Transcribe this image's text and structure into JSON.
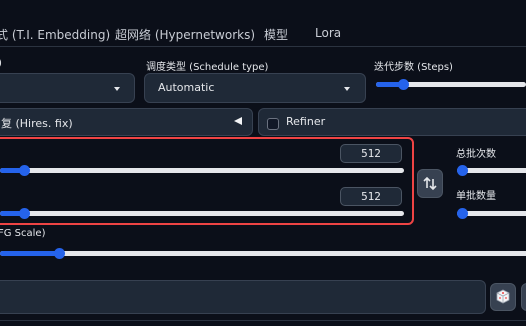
{
  "tabs": [
    {
      "label": "式 (T.I. Embedding)"
    },
    {
      "label": "超网络 (Hypernetworks)"
    },
    {
      "label": "模型"
    },
    {
      "label": "Lora"
    }
  ],
  "sampler": {
    "label": ")"
  },
  "schedule": {
    "label": "调度类型 (Schedule type)",
    "value": "Automatic"
  },
  "steps": {
    "label": "迭代步数 (Steps)",
    "fraction": 0.18
  },
  "hires": {
    "label": "复 (Hires. fix)"
  },
  "refiner": {
    "label": "Refiner",
    "checked": false
  },
  "width": {
    "value": "512",
    "fraction": 0.06
  },
  "height": {
    "value": "512",
    "fraction": 0.06
  },
  "batch_count": {
    "label": "总批次数",
    "fraction": 0.0
  },
  "batch_size": {
    "label": "单批数量",
    "fraction": 0.0
  },
  "cfg": {
    "label": "FG Scale)",
    "fraction": 0.11
  },
  "icons": {
    "swap": "swap-dimensions-icon",
    "dice": "dice-icon"
  },
  "colors": {
    "accent": "#2563eb",
    "highlight": "#ef4444",
    "background": "#0b0f19"
  }
}
